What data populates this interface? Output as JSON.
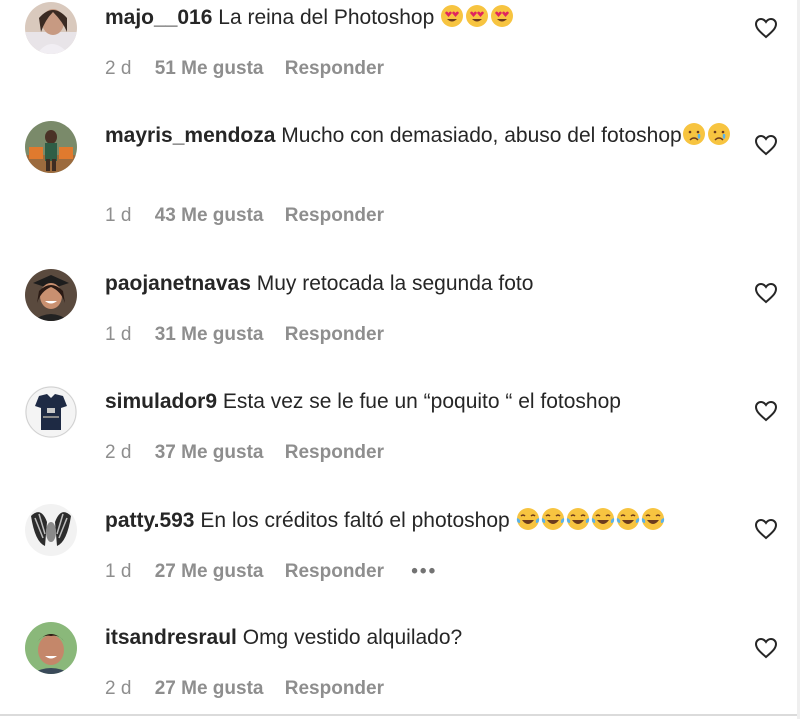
{
  "comments": [
    {
      "username": "majo__016",
      "text": "La reina del Photoshop",
      "emoji": "heart-eyes-emoji",
      "emoji_count": 3,
      "time": "2 d",
      "likes": "51 Me gusta",
      "reply": "Responder"
    },
    {
      "username": "mayris_mendoza",
      "text": "Mucho con demasiado, abuso del fotoshop",
      "emoji": "crying-face-emoji",
      "emoji_count": 2,
      "time": "1 d",
      "likes": "43 Me gusta",
      "reply": "Responder"
    },
    {
      "username": "paojanetnavas",
      "text": "Muy retocada la segunda foto",
      "time": "1 d",
      "likes": "31 Me gusta",
      "reply": "Responder"
    },
    {
      "username": "simulador9",
      "text": "Esta vez se le fue un “poquito “ el fotoshop",
      "time": "2 d",
      "likes": "37 Me gusta",
      "reply": "Responder"
    },
    {
      "username": "patty.593",
      "text": "En los créditos faltó el photoshop",
      "emoji": "tears-of-joy-emoji",
      "emoji_count": 6,
      "time": "1 d",
      "likes": "27 Me gusta",
      "reply": "Responder",
      "more": "•••"
    },
    {
      "username": "itsandresraul",
      "text": "Omg vestido alquilado?",
      "time": "2 d",
      "likes": "27 Me gusta",
      "reply": "Responder"
    }
  ],
  "colors": {
    "text": "#262626",
    "secondary": "#8e8e8e",
    "divider": "#dbdbdb"
  },
  "icons": {
    "like": "heart-outline-icon",
    "more": "more-options-icon"
  }
}
